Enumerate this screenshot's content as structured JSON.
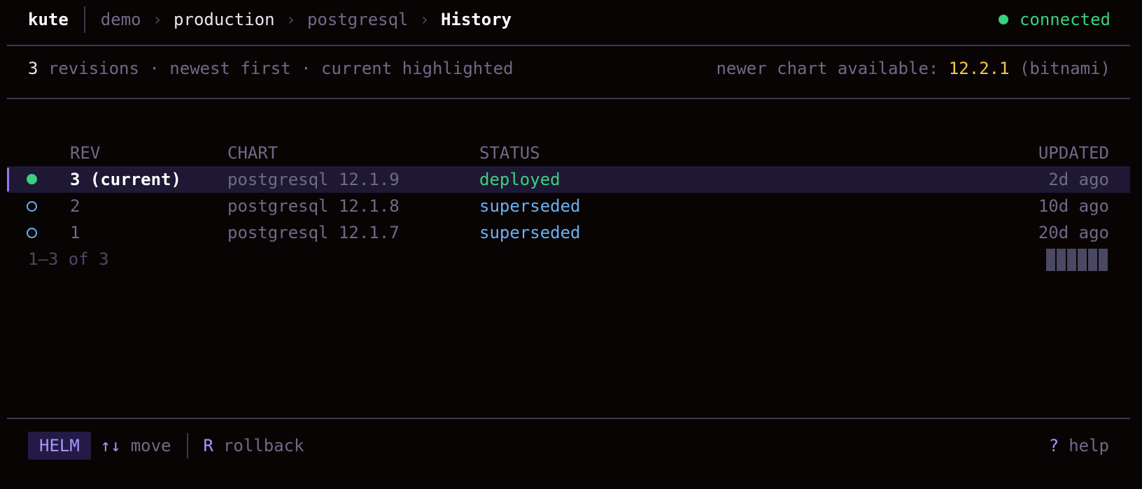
{
  "header": {
    "app_name": "kute",
    "breadcrumbs": [
      "demo",
      "production",
      "postgresql",
      "History"
    ],
    "breadcrumb_separator": "›",
    "connection_status": "connected",
    "connection_color": "#3ccf7c"
  },
  "summary": {
    "count": "3",
    "rest": " revisions · newest first · current highlighted",
    "newer_chart_label": "newer chart available: ",
    "newer_chart_version": "12.2.1",
    "newer_chart_repo": " (bitnami)"
  },
  "table": {
    "columns": {
      "rev": "REV",
      "chart": "CHART",
      "status": "STATUS",
      "updated": "UPDATED"
    },
    "rows": [
      {
        "rev": "3 (current)",
        "chart": "postgresql 12.1.9",
        "status": "deployed",
        "updated": "2d ago",
        "current": true
      },
      {
        "rev": "2",
        "chart": "postgresql 12.1.8",
        "status": "superseded",
        "updated": "10d ago",
        "current": false
      },
      {
        "rev": "1",
        "chart": "postgresql 12.1.7",
        "status": "superseded",
        "updated": "20d ago",
        "current": false
      }
    ],
    "pager": "1–3 of 3"
  },
  "footer": {
    "mode": "HELM",
    "move_key": "↑↓",
    "move_label": "move",
    "rollback_key": "R",
    "rollback_label": "rollback",
    "help_key": "?",
    "help_label": "help"
  },
  "colors": {
    "background": "#080404",
    "accent": "#a696ff",
    "deployed": "#3ccf7c",
    "superseded": "#6ab0f3",
    "highlight_row": "#1e1834",
    "version_new": "#f2c94c"
  }
}
